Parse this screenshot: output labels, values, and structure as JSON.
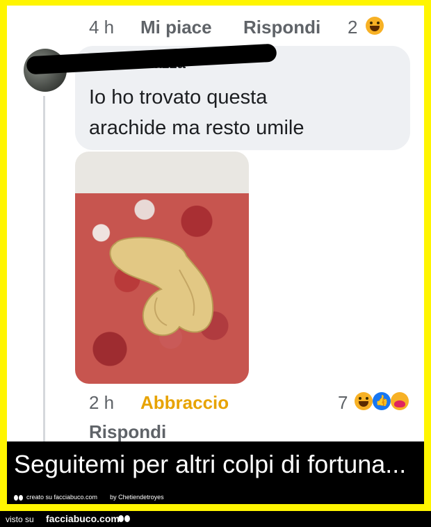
{
  "comment_top": {
    "time": "4 h",
    "like_label": "Mi piace",
    "reply_label": "Rispondi",
    "reaction_count": "2"
  },
  "comment": {
    "author_name": "Rita Bonazza",
    "text_line1": "Io ho trovato questa",
    "text_line2": "arachide ma resto umile"
  },
  "comment_bottom": {
    "time": "2 h",
    "reaction_label": "Abbraccio",
    "reaction_count": "7",
    "reply_label": "Rispondi"
  },
  "caption": {
    "text": "Seguitemi per altri colpi di fortuna...",
    "credit_created": "creato su facciabuco.com",
    "credit_by": "by Chetiendetroyes"
  },
  "footer": {
    "visto_su": "visto su",
    "site": "facciabuco.com"
  },
  "colors": {
    "frame": "#fff500",
    "hug_reaction": "#e7a300",
    "bubble": "#eef0f3"
  }
}
